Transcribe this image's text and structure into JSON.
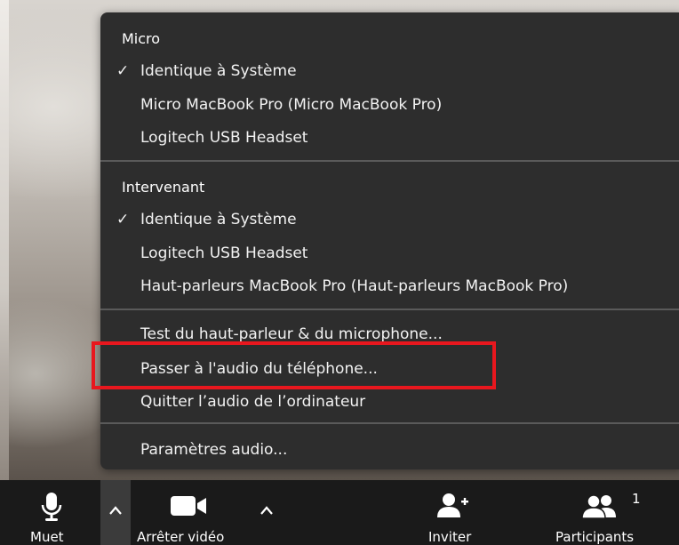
{
  "menu": {
    "sections": [
      {
        "header": "Micro",
        "items": [
          {
            "label": "Identique à Système",
            "checked": true
          },
          {
            "label": "Micro MacBook Pro (Micro MacBook Pro)",
            "checked": false
          },
          {
            "label": "Logitech USB Headset",
            "checked": false
          }
        ]
      },
      {
        "header": "Intervenant",
        "items": [
          {
            "label": "Identique à Système",
            "checked": true
          },
          {
            "label": "Logitech USB Headset",
            "checked": false
          },
          {
            "label": "Haut-parleurs MacBook Pro (Haut-parleurs MacBook Pro)",
            "checked": false
          }
        ]
      }
    ],
    "actions": [
      "Test du haut-parleur & du microphone...",
      "Passer à l'audio du téléphone...",
      "Quitter l’audio de l’ordinateur"
    ],
    "settings": "Paramètres audio...",
    "check_glyph": "✓",
    "highlight_color": "#e8171e"
  },
  "toolbar": {
    "mute_label": "Muet",
    "video_label": "Arrêter vidéo",
    "invite_label": "Inviter",
    "participants_label": "Participants",
    "participants_count": "1",
    "icons": [
      "microphone-icon",
      "caret-up-icon",
      "video-camera-icon",
      "caret-up-icon",
      "add-user-icon",
      "participants-icon"
    ]
  }
}
